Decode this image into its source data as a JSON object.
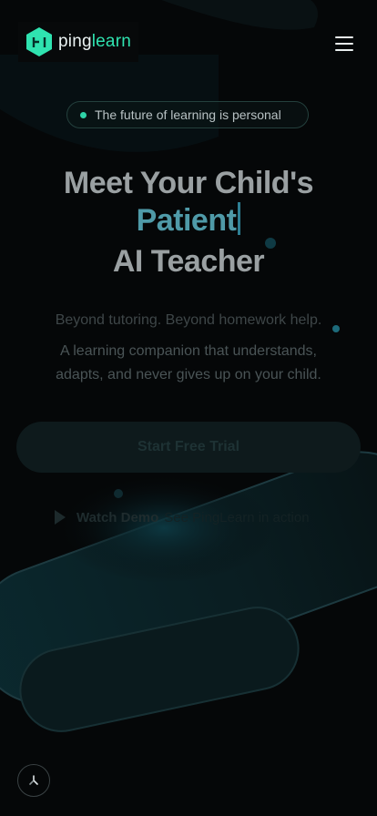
{
  "brand": {
    "name_prefix": "ping",
    "name_suffix": "learn"
  },
  "badge": {
    "text": "The future of learning is personal"
  },
  "hero": {
    "line1": "Meet Your Child's",
    "line2": "Patient",
    "line3": "AI Teacher",
    "subtitle": "Beyond tutoring. Beyond homework help.",
    "description_line1": "A learning companion that understands,",
    "description_line2": "adapts, and never gives up on your child."
  },
  "cta": {
    "label": "Start Free Trial"
  },
  "demo": {
    "label": "Watch Demo",
    "sublabel": "See PingLearn in action"
  },
  "colors": {
    "accent": "#2fe3b0",
    "background": "#050708"
  },
  "icons": {
    "menu": "hamburger-icon",
    "play": "play-icon",
    "loader": "spinner-icon"
  }
}
